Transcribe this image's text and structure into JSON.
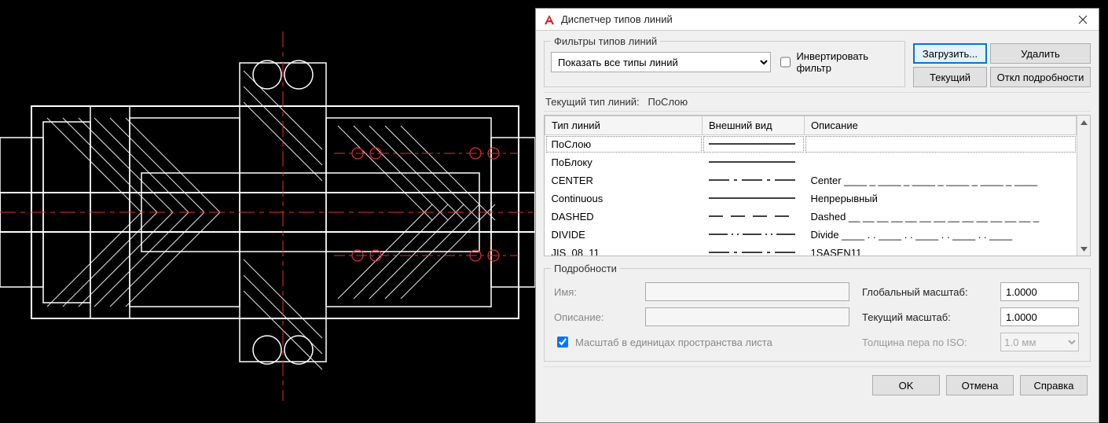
{
  "dialog": {
    "title": "Диспетчер типов линий",
    "appIconLetter": "A",
    "appIconColor": "#d12229"
  },
  "filters": {
    "legend": "Фильтры типов линий",
    "selectValue": "Показать все типы линий",
    "invertLabel": "Инвертировать фильтр",
    "invertChecked": false
  },
  "buttons": {
    "load": "Загрузить...",
    "delete": "Удалить",
    "current": "Текущий",
    "toggleDetails": "Откл подробности",
    "ok": "OK",
    "cancel": "Отмена",
    "help": "Справка"
  },
  "currentLineLabel": "Текущий тип линий:",
  "currentLineValue": "ПоСлою",
  "table": {
    "headers": {
      "name": "Тип линий",
      "preview": "Внешний вид",
      "desc": "Описание"
    },
    "rows": [
      {
        "name": "ПоСлою",
        "type": "solid",
        "desc": ""
      },
      {
        "name": "ПоБлоку",
        "type": "solid",
        "desc": ""
      },
      {
        "name": "CENTER",
        "type": "center",
        "desc": "Center ____ _ ____ _ ____ _ ____ _ ____ _ ____"
      },
      {
        "name": "Continuous",
        "type": "solid",
        "desc": "Непрерывный"
      },
      {
        "name": "DASHED",
        "type": "dashed",
        "desc": "Dashed __ __ __ __ __ __ __ __ __ __ __ __ __ _"
      },
      {
        "name": "DIVIDE",
        "type": "divide",
        "desc": "Divide ____ . . ____ . . ____ . . ____ . . ____"
      },
      {
        "name": "JIS_08_11",
        "type": "center",
        "desc": "1SASEN11"
      }
    ],
    "selectedIndex": 0
  },
  "details": {
    "legend": "Подробности",
    "nameLabel": "Имя:",
    "nameValue": "",
    "descLabel": "Описание:",
    "descValue": "",
    "globalScaleLabel": "Глобальный масштаб:",
    "globalScaleValue": "1.0000",
    "currentScaleLabel": "Текущий масштаб:",
    "currentScaleValue": "1.0000",
    "isoLabel": "Толщина пера по ISO:",
    "isoValue": "1.0 мм",
    "paperUnitsLabel": "Масштаб в единицах пространства листа",
    "paperUnitsChecked": true
  }
}
